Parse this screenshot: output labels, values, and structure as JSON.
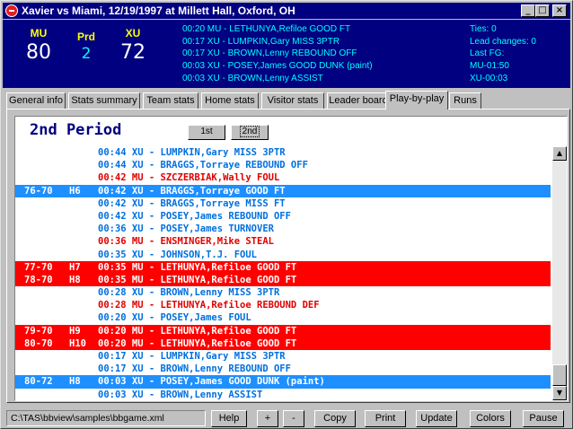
{
  "window": {
    "title": "Xavier vs Miami, 12/19/1997 at Millett Hall, Oxford, OH",
    "min_glyph": "_",
    "max_glyph": "□",
    "close_glyph": "×"
  },
  "scoreboard": {
    "home_team": "MU",
    "home_score": "80",
    "period_label": "Prd",
    "period": "2",
    "away_team": "XU",
    "away_score": "72",
    "recent_plays": [
      "00:20 MU - LETHUNYA,Refiloe GOOD FT",
      "00:17 XU - LUMPKIN,Gary MISS 3PTR",
      "00:17 XU - BROWN,Lenny REBOUND OFF",
      "00:03 XU - POSEY,James GOOD DUNK (paint)",
      "00:03 XU - BROWN,Lenny ASSIST"
    ],
    "stats": [
      "Ties: 0",
      "Lead changes: 0",
      "Last FG:",
      "MU-01:50",
      "XU-00:03"
    ]
  },
  "tabs": [
    "General info",
    "Stats summary",
    "Team stats",
    "Home stats",
    "Visitor stats",
    "Leader board",
    "Play-by-play",
    "Runs"
  ],
  "active_tab": "Play-by-play",
  "play_by_play": {
    "period_title": "2nd Period",
    "period_buttons": [
      "1st",
      "2nd"
    ],
    "rows": [
      {
        "score": "",
        "lead": "",
        "text": "00:44 XU - LUMPKIN,Gary MISS 3PTR",
        "team": "XU",
        "highlight": false
      },
      {
        "score": "",
        "lead": "",
        "text": "00:44 XU - BRAGGS,Torrayе REBOUND OFF",
        "team": "XU",
        "highlight": false
      },
      {
        "score": "",
        "lead": "",
        "text": "00:42 MU - SZCZERBIAK,Wally FOUL",
        "team": "MU",
        "highlight": false
      },
      {
        "score": "76-70",
        "lead": "H6",
        "text": "00:42 XU - BRAGGS,Torraye GOOD FT",
        "team": "XU",
        "highlight": true
      },
      {
        "score": "",
        "lead": "",
        "text": "00:42 XU - BRAGGS,Torraye MISS FT",
        "team": "XU",
        "highlight": false
      },
      {
        "score": "",
        "lead": "",
        "text": "00:42 XU - POSEY,James REBOUND OFF",
        "team": "XU",
        "highlight": false
      },
      {
        "score": "",
        "lead": "",
        "text": "00:36 XU - POSEY,James TURNOVER",
        "team": "XU",
        "highlight": false
      },
      {
        "score": "",
        "lead": "",
        "text": "00:36 MU - ENSMINGER,Mike STEAL",
        "team": "MU",
        "highlight": false
      },
      {
        "score": "",
        "lead": "",
        "text": "00:35 XU - JOHNSON,T.J. FOUL",
        "team": "XU",
        "highlight": false
      },
      {
        "score": "77-70",
        "lead": "H7",
        "text": "00:35 MU - LETHUNYA,Refiloe GOOD FT",
        "team": "MU",
        "highlight": true
      },
      {
        "score": "78-70",
        "lead": "H8",
        "text": "00:35 MU - LETHUNYA,Refiloe GOOD FT",
        "team": "MU",
        "highlight": true
      },
      {
        "score": "",
        "lead": "",
        "text": "00:28 XU - BROWN,Lenny MISS 3PTR",
        "team": "XU",
        "highlight": false
      },
      {
        "score": "",
        "lead": "",
        "text": "00:28 MU - LETHUNYA,Refiloe REBOUND DEF",
        "team": "MU",
        "highlight": false
      },
      {
        "score": "",
        "lead": "",
        "text": "00:20 XU - POSEY,James FOUL",
        "team": "XU",
        "highlight": false
      },
      {
        "score": "79-70",
        "lead": "H9",
        "text": "00:20 MU - LETHUNYA,Refiloe GOOD FT",
        "team": "MU",
        "highlight": true
      },
      {
        "score": "80-70",
        "lead": "H10",
        "text": "00:20 MU - LETHUNYA,Refiloe GOOD FT",
        "team": "MU",
        "highlight": true
      },
      {
        "score": "",
        "lead": "",
        "text": "00:17 XU - LUMPKIN,Gary MISS 3PTR",
        "team": "XU",
        "highlight": false
      },
      {
        "score": "",
        "lead": "",
        "text": "00:17 XU - BROWN,Lenny REBOUND OFF",
        "team": "XU",
        "highlight": false
      },
      {
        "score": "80-72",
        "lead": "H8",
        "text": "00:03 XU - POSEY,James GOOD DUNK (paint)",
        "team": "XU",
        "highlight": true
      },
      {
        "score": "",
        "lead": "",
        "text": "00:03 XU - BROWN,Lenny ASSIST",
        "team": "XU",
        "highlight": false
      }
    ]
  },
  "statusbar": {
    "path": "C:\\TAS\\bbview\\samples\\bbgame.xml",
    "buttons": [
      "Help",
      "+",
      "-",
      "Copy",
      "Print",
      "Update",
      "Colors",
      "Pause"
    ]
  },
  "colors": {
    "title_bar": "#000080",
    "scoreboard_bg": "#000080",
    "team_label": "#ffff00",
    "info_text": "#00ffff",
    "xu_text": "#0070e0",
    "mu_text": "#e00000",
    "xu_highlight": "#1e8fff",
    "mu_highlight": "#ff0000"
  }
}
